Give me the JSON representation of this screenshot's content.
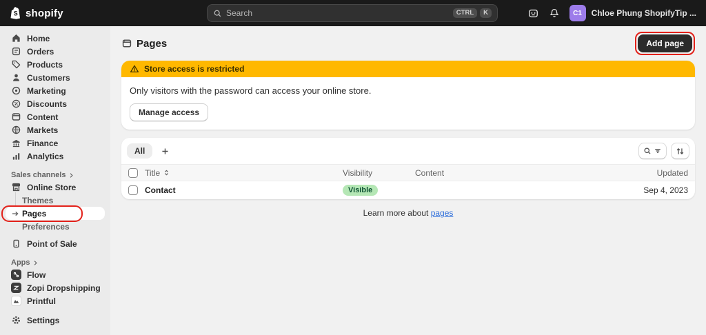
{
  "topbar": {
    "brand": "shopify",
    "search_placeholder": "Search",
    "kbd_ctrl": "CTRL",
    "kbd_k": "K",
    "user_initials": "C1",
    "user_name": "Chloe Phung ShopifyTip ..."
  },
  "sidebar": {
    "items": [
      {
        "label": "Home"
      },
      {
        "label": "Orders"
      },
      {
        "label": "Products"
      },
      {
        "label": "Customers"
      },
      {
        "label": "Marketing"
      },
      {
        "label": "Discounts"
      },
      {
        "label": "Content"
      },
      {
        "label": "Markets"
      },
      {
        "label": "Finance"
      },
      {
        "label": "Analytics"
      }
    ],
    "sales_channels_label": "Sales channels",
    "online_store_label": "Online Store",
    "themes_label": "Themes",
    "pages_label": "Pages",
    "preferences_label": "Preferences",
    "point_of_sale_label": "Point of Sale",
    "apps_label": "Apps",
    "apps": [
      {
        "label": "Flow"
      },
      {
        "label": "Zopi Dropshipping"
      },
      {
        "label": "Printful"
      }
    ],
    "settings_label": "Settings"
  },
  "page": {
    "title": "Pages",
    "add_page_button": "Add page",
    "banner": {
      "title": "Store access is restricted",
      "message": "Only visitors with the password can access your online store.",
      "action": "Manage access"
    },
    "table": {
      "tab_all": "All",
      "columns": {
        "title": "Title",
        "visibility": "Visibility",
        "content": "Content",
        "updated": "Updated"
      },
      "rows": [
        {
          "title": "Contact",
          "visibility": "Visible",
          "content": "",
          "updated": "Sep 4, 2023"
        }
      ]
    },
    "footer_text": "Learn more about",
    "footer_link": "pages"
  },
  "colors": {
    "topbar_bg": "#1a1a1a",
    "sidebar_bg": "#ebebeb",
    "main_bg": "#f1f1f1",
    "warning_banner": "#ffb800",
    "badge_success_bg": "#b5e7b5",
    "badge_success_text": "#0c5132",
    "link_blue": "#2f6fdb",
    "annotation_red": "#e3211a",
    "avatar_purple": "#9d7cea"
  }
}
